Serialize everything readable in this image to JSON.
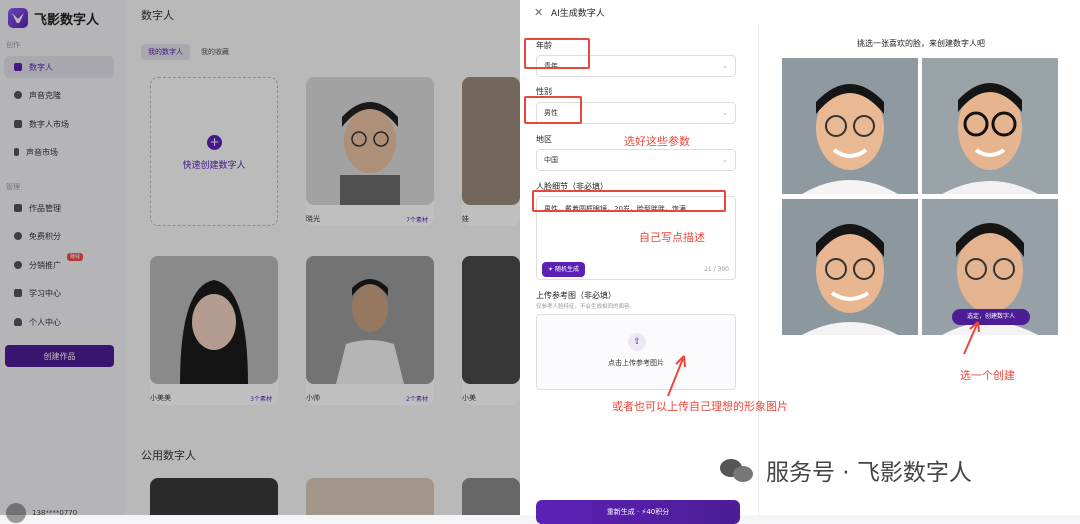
{
  "app": {
    "brand": "飞影数字人"
  },
  "sidebar": {
    "section_create": "创作",
    "section_manage": "管理",
    "items_create": [
      {
        "label": "数字人",
        "icon": "person-icon"
      },
      {
        "label": "声音克隆",
        "icon": "sound-icon"
      },
      {
        "label": "数字人市场",
        "icon": "grid-icon"
      },
      {
        "label": "声音市场",
        "icon": "mic-icon"
      }
    ],
    "items_manage": [
      {
        "label": "作品管理",
        "icon": "video-icon"
      },
      {
        "label": "免费积分",
        "icon": "coin-icon"
      },
      {
        "label": "分销推广",
        "icon": "share-icon",
        "badge": "赚钱"
      },
      {
        "label": "学习中心",
        "icon": "book-icon"
      },
      {
        "label": "个人中心",
        "icon": "user-icon"
      }
    ],
    "create_button": "创建作品",
    "user_phone": "138****0770"
  },
  "main": {
    "title": "数字人",
    "tabs": [
      "我的数字人",
      "我的收藏"
    ],
    "create_card_label": "快速创建数字人",
    "cards": [
      {
        "name": "晓光",
        "material": "7个素材"
      },
      {
        "name": "娃",
        "material": ""
      },
      {
        "name": "小美美",
        "material": "3个素材"
      },
      {
        "name": "小帅",
        "material": "2个素材"
      },
      {
        "name": "小美",
        "material": ""
      }
    ],
    "public_title": "公用数字人"
  },
  "panel": {
    "title": "AI生成数字人",
    "age_label": "年龄",
    "age_value": "青年",
    "gender_label": "性别",
    "gender_value": "男性",
    "region_label": "地区",
    "region_value": "中国",
    "face_label": "人脸细节（非必填）",
    "face_value": "男性，戴着圆框眼镜，20岁，脸型胖胖，饱满",
    "random_button": "随机生成",
    "char_count": "21 / 300",
    "upload_label": "上传参考图（非必填）",
    "upload_help": "仅参考人脸特征，不会生成相同的面容。",
    "upload_text": "点击上传参考图片",
    "regen_button": "重新生成 · ⚡40积分",
    "pick_title": "挑选一张喜欢的脸，来创建数字人吧",
    "select_button": "选定，创建数字人"
  },
  "annotations": {
    "params": "选好这些参数",
    "describe": "自己写点描述",
    "upload": "或者也可以上传自己理想的形象图片",
    "pick_one": "选一个创建"
  },
  "watermark": "服务号 · 飞影数字人",
  "colors": {
    "accent": "#5b21b6",
    "annotation": "#e8483b"
  }
}
